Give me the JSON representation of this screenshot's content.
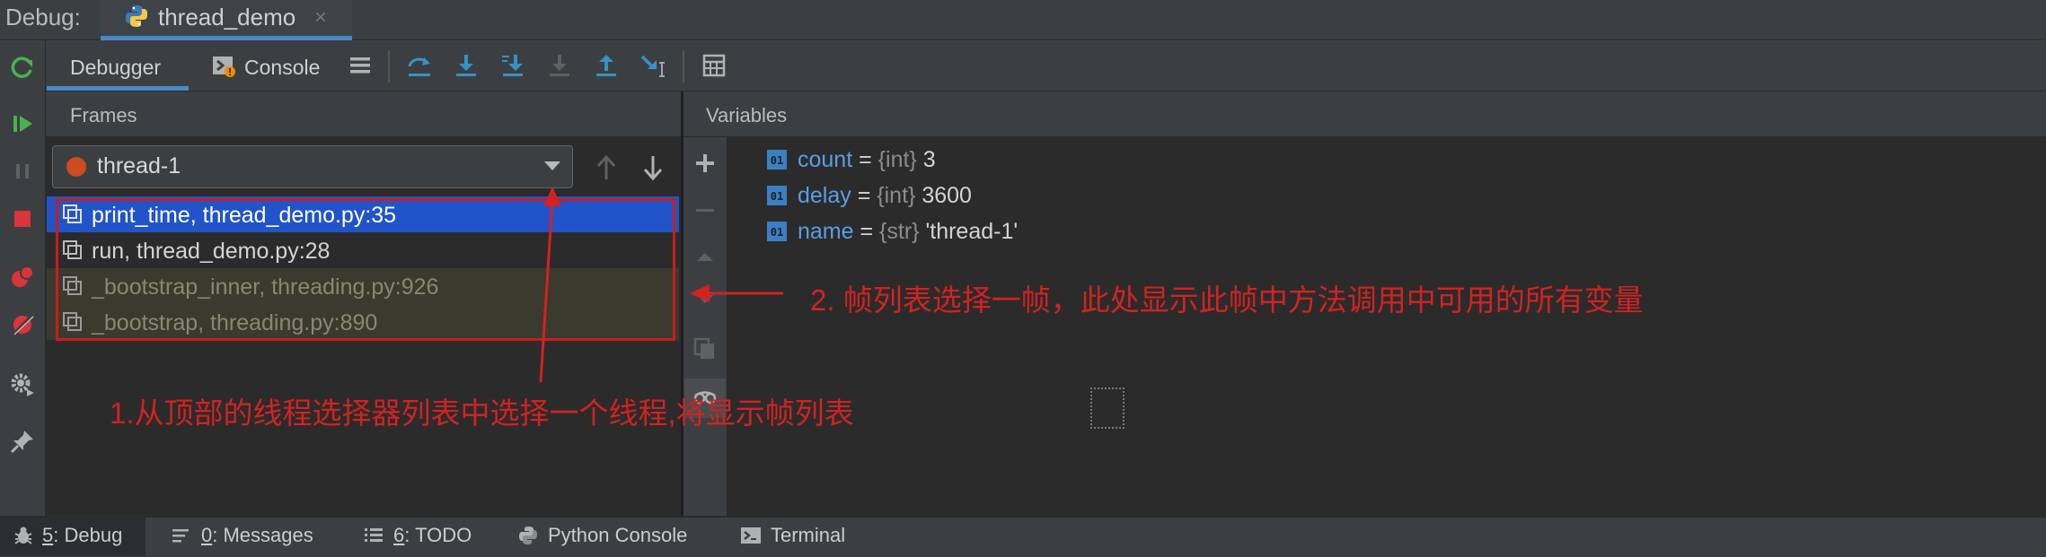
{
  "window": {
    "debug_label": "Debug:",
    "run_tab_title": "thread_demo",
    "close_glyph": "×"
  },
  "tool_tabs": {
    "debugger": "Debugger",
    "console": "Console"
  },
  "frames": {
    "title": "Frames",
    "selected_thread": "thread-1",
    "rows": [
      {
        "label": "print_time, thread_demo.py:35",
        "color": "#ffffff"
      },
      {
        "label": "run, thread_demo.py:28",
        "color": "#d4d4d4"
      },
      {
        "label": "_bootstrap_inner, threading.py:926",
        "color": "#8a8770"
      },
      {
        "label": "_bootstrap, threading.py:890",
        "color": "#8a8770"
      }
    ]
  },
  "variables": {
    "title": "Variables",
    "items": [
      {
        "name": "count",
        "eq": " = ",
        "type": "{int}",
        "value": " 3"
      },
      {
        "name": "delay",
        "eq": " = ",
        "type": "{int}",
        "value": " 3600"
      },
      {
        "name": "name",
        "eq": " = ",
        "type": "{str}",
        "value": " 'thread-1'"
      }
    ]
  },
  "annotations": {
    "step1": "1.从顶部的线程选择器列表中选择一个线程,将显示帧列表",
    "step2": "2. 帧列表选择一帧，此处显示此帧中方法调用中可用的所有变量"
  },
  "bottom_tabs": [
    {
      "key": "5",
      "label": ": Debug"
    },
    {
      "key": "0",
      "label": ": Messages"
    },
    {
      "key": "6",
      "label": ": TODO"
    },
    {
      "key": "",
      "label": "Python Console"
    },
    {
      "key": "",
      "label": "Terminal"
    }
  ],
  "colors": {
    "accent": "#4a88c7",
    "selection": "#2154c8",
    "annotation": "#d22222",
    "thread_dot": "#cc4b1f"
  },
  "icons": {
    "left_toolbar": [
      "rerun-icon",
      "resume-icon",
      "pause-icon",
      "stop-icon",
      "view-breakpoints-icon",
      "mute-breakpoints-icon",
      "settings-icon",
      "pin-icon"
    ],
    "toolbar": [
      "layout-menu-icon",
      "step-over-icon",
      "step-into-icon",
      "step-into-my-code-icon",
      "force-step-into-icon",
      "step-out-icon",
      "run-to-cursor-icon",
      "evaluate-expression-icon"
    ]
  }
}
